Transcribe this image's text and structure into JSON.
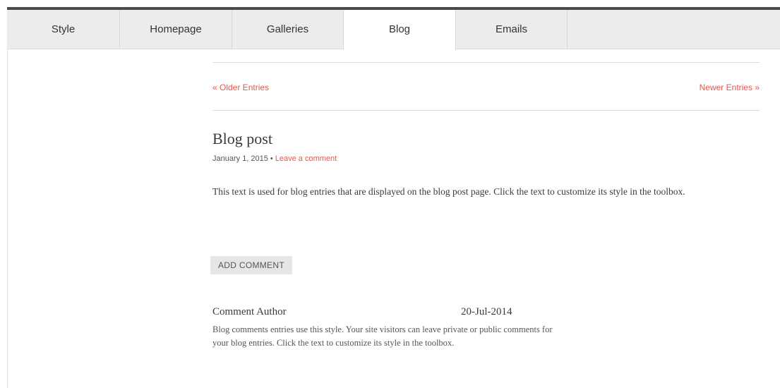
{
  "tabs": [
    {
      "label": "Style"
    },
    {
      "label": "Homepage"
    },
    {
      "label": "Galleries"
    },
    {
      "label": "Blog",
      "active": true
    },
    {
      "label": "Emails"
    }
  ],
  "nav": {
    "older": "« Older Entries",
    "newer": "Newer Entries »"
  },
  "post": {
    "title": "Blog post",
    "date": "January 1, 2015",
    "separator": "•",
    "comment_link": "Leave a comment",
    "body": "This text is used for blog entries that are displayed on the blog post page. Click the text to customize its style in the toolbox."
  },
  "add_comment_label": "ADD COMMENT",
  "comment": {
    "author": "Comment Author",
    "date": "20-Jul-2014",
    "text": "Blog comments entries use this style. Your site visitors can leave private or public comments for your blog entries. Click the text to customize its style in the toolbox."
  },
  "colors": {
    "accent": "#e4574d",
    "tabbar": "#ececec",
    "top_border": "#4a4a4a"
  }
}
